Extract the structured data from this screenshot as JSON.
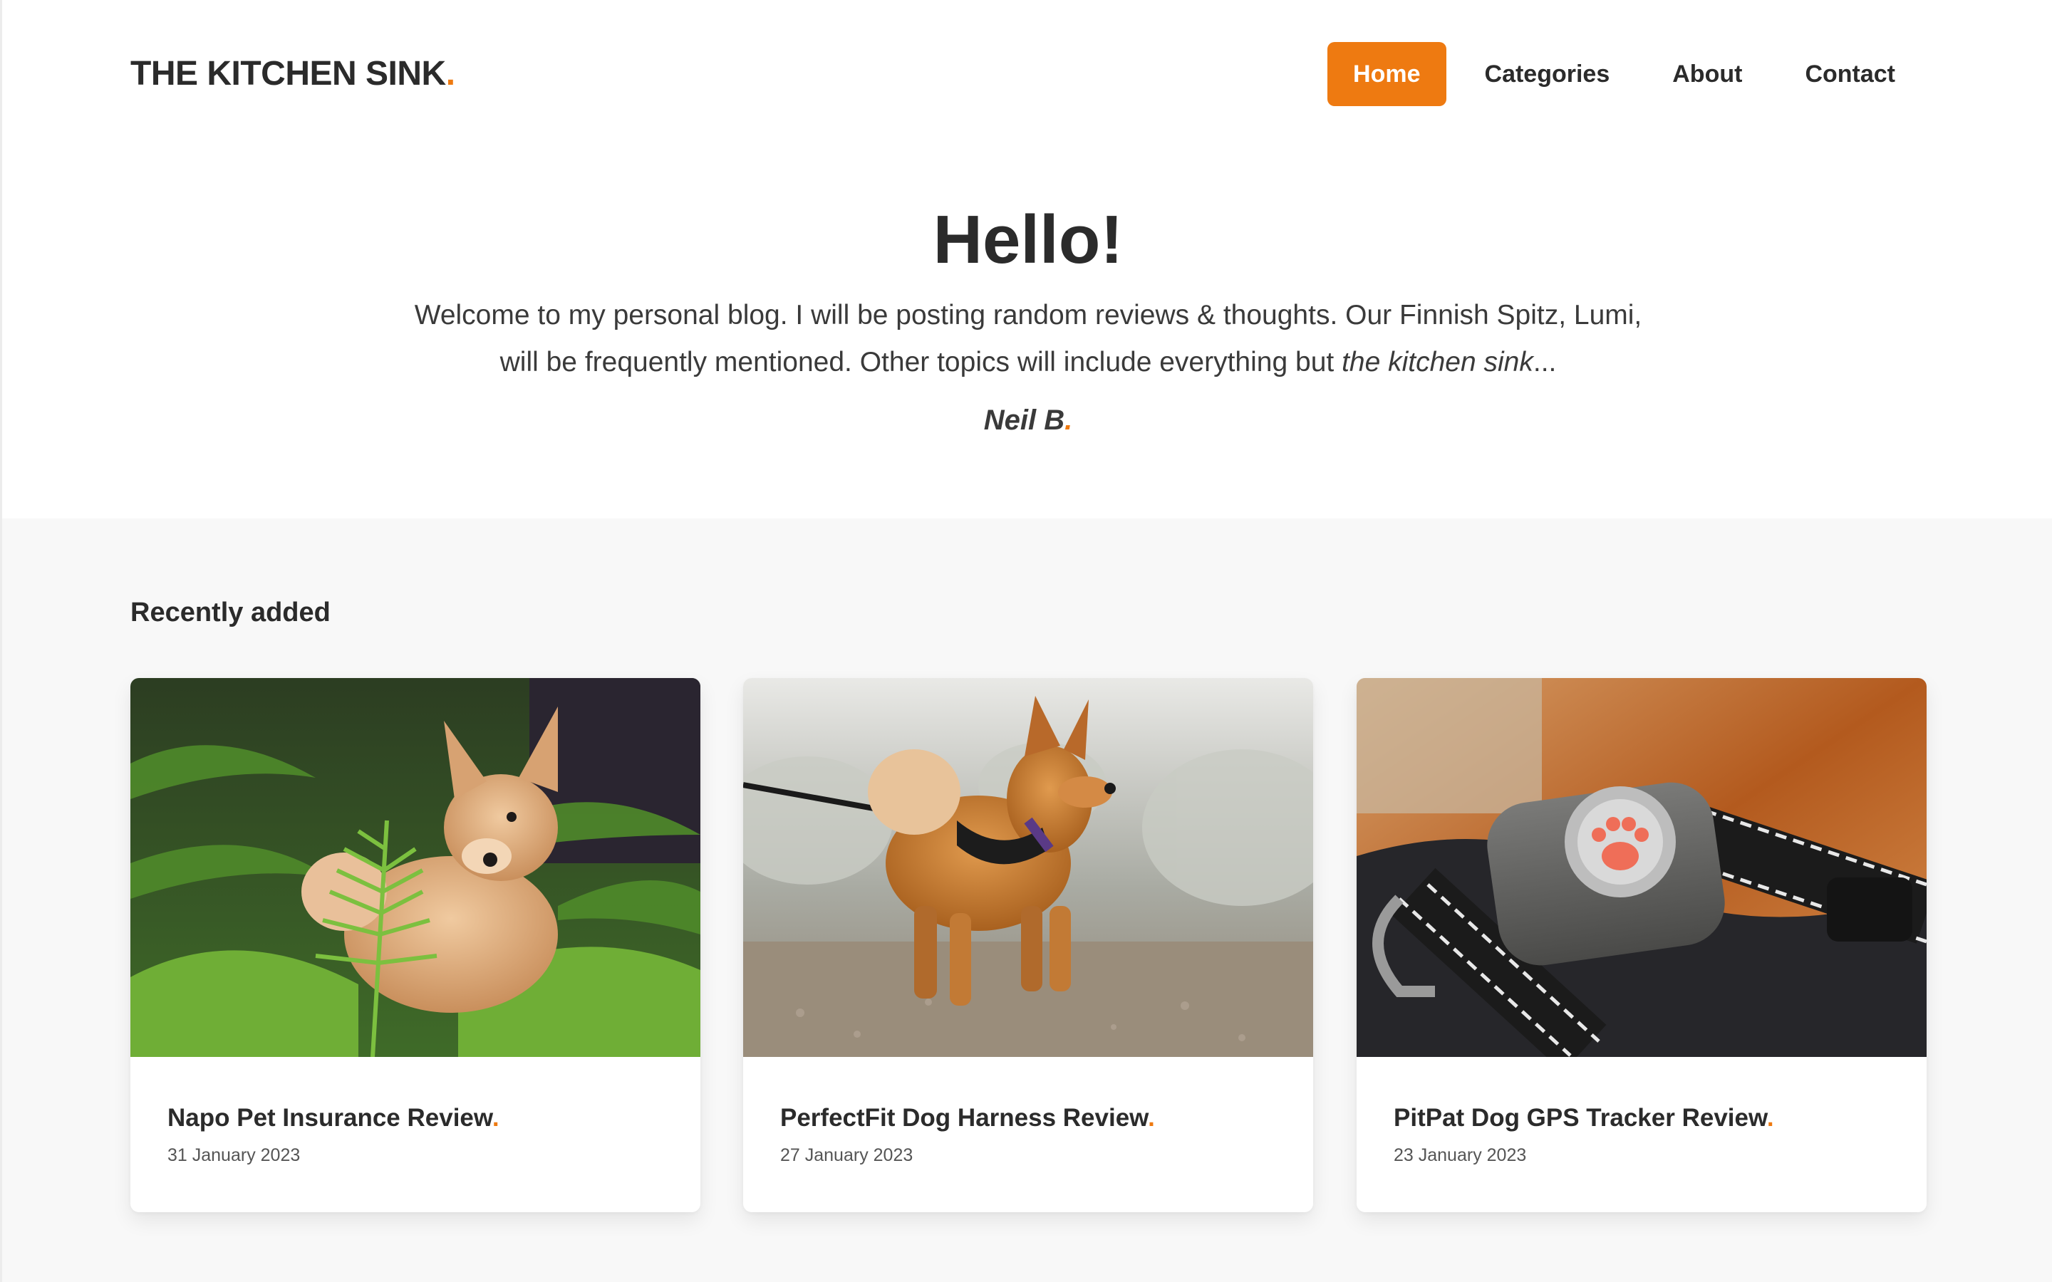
{
  "site": {
    "brand_name": "THE KITCHEN SINK",
    "brand_dot": "."
  },
  "nav": {
    "items": [
      {
        "label": "Home",
        "active": true
      },
      {
        "label": "Categories",
        "active": false
      },
      {
        "label": "About",
        "active": false
      },
      {
        "label": "Contact",
        "active": false
      }
    ]
  },
  "hero": {
    "title": "Hello!",
    "intro_line1": "Welcome to my personal blog. I will be posting random reviews & thoughts. Our Finnish Spitz, Lumi,",
    "intro_line2_prefix": "will be frequently mentioned. Other topics will include everything but ",
    "intro_line2_italic": "the kitchen sink",
    "intro_line2_suffix": "...",
    "signature": "Neil B",
    "signature_dot": "."
  },
  "recent": {
    "heading": "Recently added",
    "posts": [
      {
        "title": "Napo Pet Insurance Review",
        "dot": ".",
        "date": "31 January 2023",
        "image": "dog-in-ferns-photo"
      },
      {
        "title": "PerfectFit Dog Harness Review",
        "dot": ".",
        "date": "27 January 2023",
        "image": "dog-harness-frost-photo"
      },
      {
        "title": "PitPat Dog GPS Tracker Review",
        "dot": ".",
        "date": "23 January 2023",
        "image": "gps-tracker-closeup-photo"
      }
    ]
  },
  "colors": {
    "accent": "#ee7a11",
    "text": "#2b2b2b",
    "section_bg": "#f8f8f8"
  }
}
